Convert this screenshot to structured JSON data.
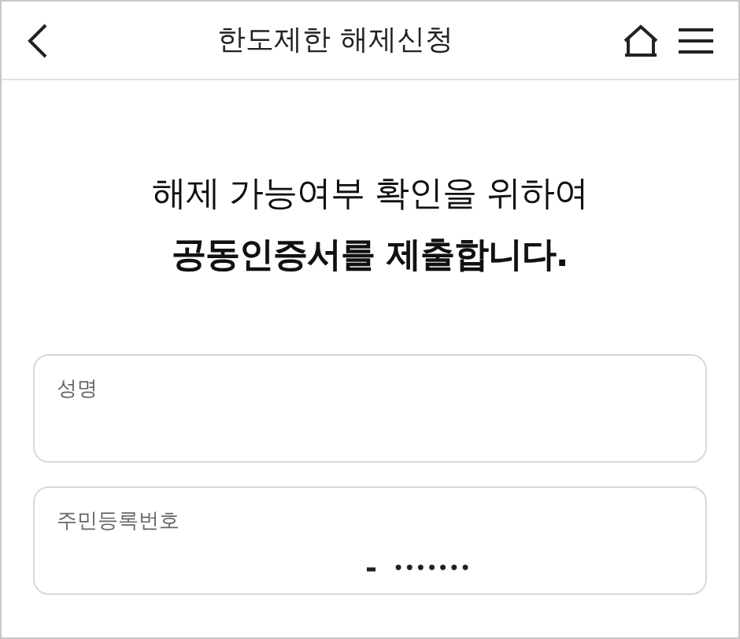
{
  "header": {
    "title": "한도제한 해제신청"
  },
  "heading": {
    "line": "해제 가능여부 확인을 위하여",
    "emphasis": "공동인증서를 제출합니다."
  },
  "fields": [
    {
      "kind": "text",
      "label": "성명"
    },
    {
      "kind": "rrn",
      "label": "주민등록번호",
      "separator": "-",
      "masked": "•••••••"
    }
  ]
}
